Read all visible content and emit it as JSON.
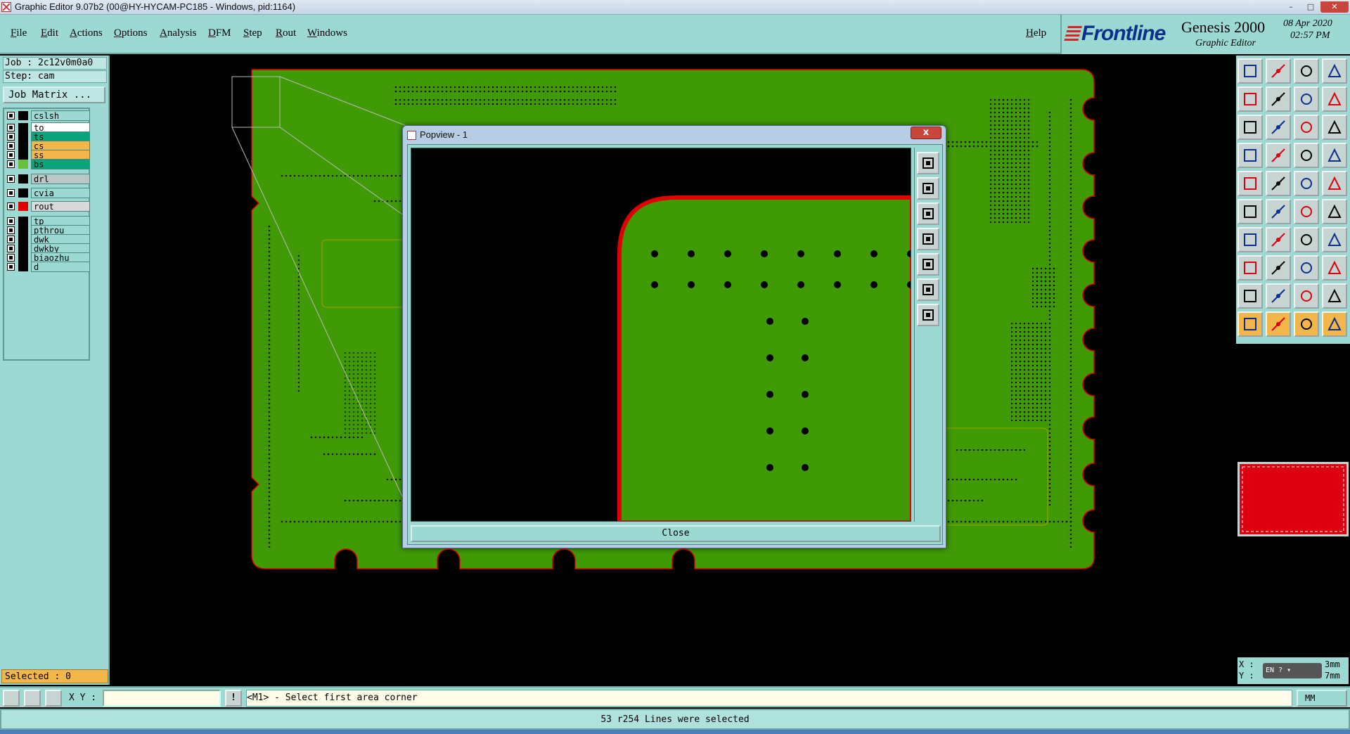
{
  "window": {
    "title": "Graphic Editor 9.07b2 (00@HY-HYCAM-PC185 - Windows, pid:1164)",
    "minimize": "–",
    "maximize": "□",
    "close": "✕"
  },
  "menubar": {
    "items": [
      "File",
      "Edit",
      "Actions",
      "Options",
      "Analysis",
      "DFM",
      "Step",
      "Rout",
      "Windows"
    ],
    "help": "Help"
  },
  "brand": {
    "logo": "Frontline",
    "product": "Genesis 2000",
    "subtitle": "Graphic Editor",
    "date": "08 Apr 2020",
    "time": "02:57 PM"
  },
  "leftpanel": {
    "job": "Job : 2c12v0m0a0",
    "step": "Step: cam",
    "job_matrix": "Job Matrix ...",
    "layers": [
      {
        "name": "cslsh",
        "color": "#9cd9d3",
        "swatch": "#000000"
      },
      {
        "name": "to",
        "color": "#ffffff",
        "swatch": "#000000"
      },
      {
        "name": "ts",
        "color": "#0aa37a",
        "swatch": "#000000"
      },
      {
        "name": "cs",
        "color": "#f2b64a",
        "swatch": "#000000"
      },
      {
        "name": "ss",
        "color": "#f2b64a",
        "swatch": "#000000"
      },
      {
        "name": "bs",
        "color": "#0aa37a",
        "swatch": "#6abf3a"
      },
      {
        "name": "drl",
        "color": "#b9c7c5",
        "swatch": "#000000"
      },
      {
        "name": "cvia",
        "color": "#9cd9d3",
        "swatch": "#000000"
      },
      {
        "name": "rout",
        "color": "#d9d9d9",
        "swatch": "#e00000"
      },
      {
        "name": "tp",
        "color": "#9cd9d3",
        "swatch": "#000000"
      },
      {
        "name": "pthrou",
        "color": "#9cd9d3",
        "swatch": "#000000"
      },
      {
        "name": "dwk",
        "color": "#9cd9d3",
        "swatch": "#000000"
      },
      {
        "name": "dwkby",
        "color": "#9cd9d3",
        "swatch": "#000000"
      },
      {
        "name": "biaozhu",
        "color": "#9cd9d3",
        "swatch": "#000000"
      },
      {
        "name": "d",
        "color": "#9cd9d3",
        "swatch": "#000000"
      }
    ],
    "selected": "Selected : 0"
  },
  "popview": {
    "title": "Popview - 1",
    "close_x": "x",
    "close_button": "Close"
  },
  "cmdbar": {
    "xy_label": "X Y :",
    "xy_value": "",
    "prompt": "<M1> - Select first area corner",
    "units": "MM"
  },
  "coords": {
    "x_label": "X :",
    "y_label": "Y :",
    "x_value": "3mm",
    "y_value": "7mm",
    "ime": "EN"
  },
  "status": {
    "message": "53 r254 Lines were selected"
  },
  "colors": {
    "panel": "#9cd9d3",
    "board": "#3f9a06",
    "outline": "#e00000",
    "highlight": "#f2b64a"
  }
}
